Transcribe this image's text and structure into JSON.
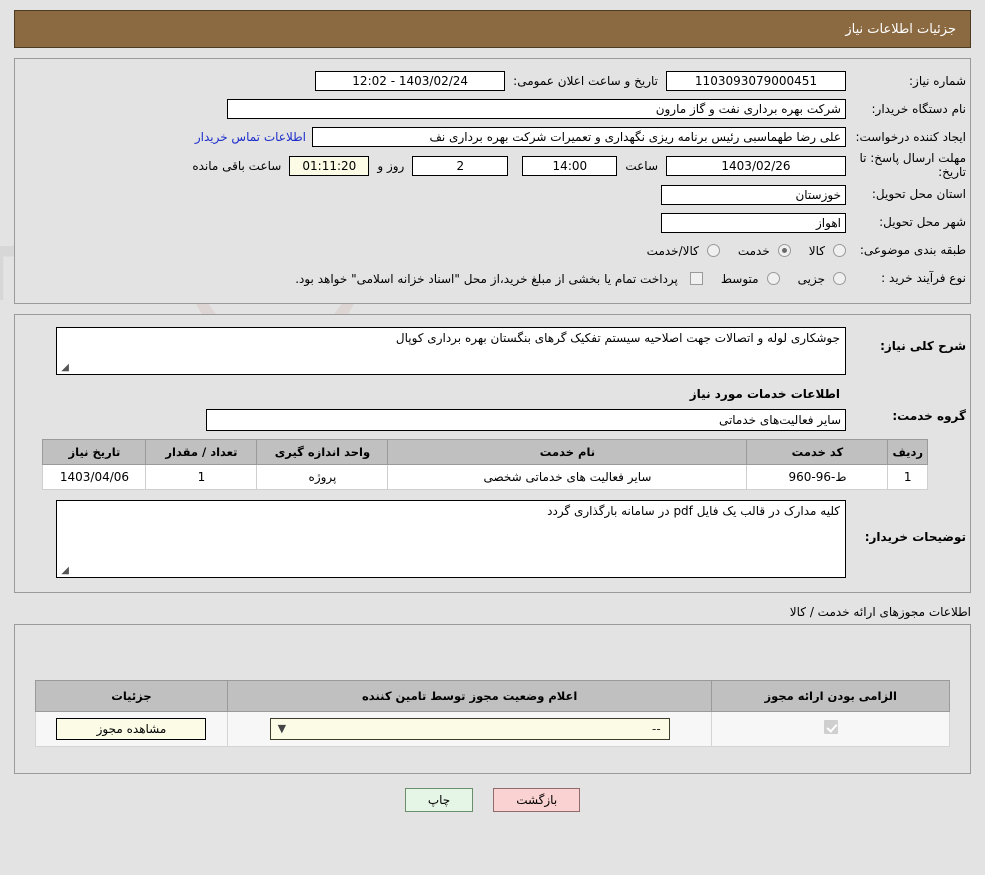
{
  "header": {
    "title": "جزئیات اطلاعات نیاز"
  },
  "info": {
    "need_number_label": "شماره نیاز:",
    "need_number_value": "1103093079000451",
    "public_announce_label": "تاریخ و ساعت اعلان عمومی:",
    "public_announce_value": "1403/02/24 - 12:02",
    "buyer_org_label": "نام دستگاه خریدار:",
    "buyer_org_value": "شرکت بهره برداری نفت و گاز مارون",
    "requester_label": "ایجاد کننده درخواست:",
    "requester_value": "علی رضا طهماسبی رئیس برنامه ریزی نگهداری و تعمیرات شرکت بهره برداری نف",
    "buyer_contact_link": "اطلاعات تماس خریدار",
    "deadline_label": "مهلت ارسال پاسخ: تا تاریخ:",
    "deadline_date": "1403/02/26",
    "hour_label": "ساعت",
    "deadline_time": "14:00",
    "days_remaining": "2",
    "days_label": "روز و",
    "countdown": "01:11:20",
    "countdown_suffix": "ساعت باقی مانده",
    "province_label": "استان محل تحویل:",
    "province_value": "خوزستان",
    "city_label": "شهر محل تحویل:",
    "city_value": "اهواز",
    "category_label": "طبقه بندی موضوعی:",
    "category_options": [
      {
        "label": "کالا",
        "checked": false
      },
      {
        "label": "خدمت",
        "checked": true
      },
      {
        "label": "کالا/خدمت",
        "checked": false
      }
    ],
    "process_label": "نوع فرآیند خرید :",
    "process_options": [
      {
        "label": "جزیی",
        "checked": false
      },
      {
        "label": "متوسط",
        "checked": false
      }
    ],
    "treasury_note": "پرداخت تمام یا بخشی از مبلغ خرید،از محل \"اسناد خزانه اسلامی\" خواهد بود."
  },
  "description": {
    "general_need_label": "شرح کلی نیاز:",
    "general_need_value": "جوشکاری لوله و اتصالات جهت اصلاحیه سیستم تفکیک گرهای بنگستان بهره برداری کوپال",
    "services_section_title": "اطلاعات خدمات مورد نیاز",
    "service_group_label": "گروه خدمت:",
    "service_group_value": "سایر فعالیت‌های خدماتی"
  },
  "services_table": {
    "columns": [
      "ردیف",
      "کد خدمت",
      "نام خدمت",
      "واحد اندازه گیری",
      "تعداد / مقدار",
      "تاریخ نیاز"
    ],
    "rows": [
      {
        "row_no": "1",
        "service_code": "ط-96-960",
        "service_name": "سایر فعالیت های خدماتی شخصی",
        "unit": "پروژه",
        "quantity": "1",
        "need_date": "1403/04/06"
      }
    ]
  },
  "buyer_notes": {
    "label": "توضیحات خریدار:",
    "value": "کلیه مدارک در قالب یک فایل pdf در سامانه بارگذاری گردد"
  },
  "permits": {
    "caption": "اطلاعات مجوزهای ارائه خدمت / کالا",
    "columns": [
      "الزامی بودن ارائه مجوز",
      "اعلام وضعیت مجوز توسط تامین کننده",
      "جزئیات"
    ],
    "rows": [
      {
        "required_checked": true,
        "status_value": "--",
        "details_button": "مشاهده مجوز"
      }
    ]
  },
  "footer": {
    "print_label": "چاپ",
    "back_label": "بازگشت"
  },
  "colors": {
    "header_brown": "#8b6a42",
    "page_bg": "#e3e3e3",
    "link_blue": "#1c2ecb",
    "print_green": "#e6f6e6",
    "back_pink": "#fbd2d2",
    "yellow_field": "#fbfbe6",
    "table_header_gray": "#c0c0c0"
  }
}
